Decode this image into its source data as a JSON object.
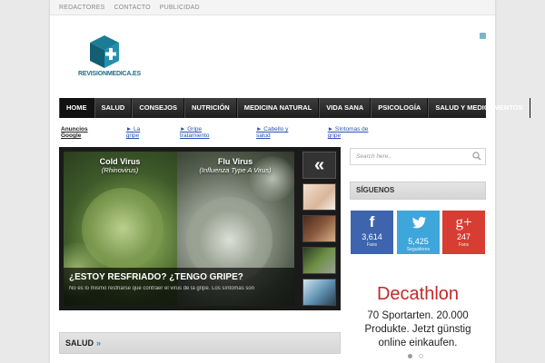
{
  "topbar": {
    "links": [
      "REDACTORES",
      "CONTACTO",
      "PUBLICIDAD"
    ]
  },
  "logo": {
    "text": "REVISIONMEDICA.ES",
    "icon": "medical-cube-logo"
  },
  "nav": {
    "items": [
      "HOME",
      "SALUD",
      "CONSEJOS",
      "NUTRICIÓN",
      "MEDICINA NATURAL",
      "VIDA SANA",
      "PSICOLOGÍA",
      "SALUD Y MEDICAMENTOS"
    ],
    "active": "HOME"
  },
  "adlinks": {
    "title": "Anuncios Google",
    "links": [
      "► La gripe",
      "► Gripe tratamiento",
      "► Cabello y salud",
      "► Síntomas de gripe"
    ]
  },
  "slider": {
    "left_label": "Cold Virus",
    "left_sub": "(Rhinovirus)",
    "right_label": "Flu Virus",
    "right_sub": "(Influenza Type A Virus)",
    "caption_title": "¿ESTOY RESFRIADO? ¿TENGO GRIPE?",
    "caption_excerpt": "No es lo mismo resfriarse que contraer el virus de la gripe. Los síntomas son",
    "prev_arrow": "«"
  },
  "section": {
    "title": "SALUD",
    "arrows": "»"
  },
  "search": {
    "placeholder": "Search here.."
  },
  "follow": {
    "title": "SÍGUENOS",
    "facebook": {
      "glyph": "f",
      "count": "3,614",
      "unit": "Fans"
    },
    "twitter": {
      "glyph": "t",
      "count": "5,425",
      "unit": "Seguidores"
    },
    "googleplus": {
      "glyph": "g+",
      "count": "247",
      "unit": "Fans"
    }
  },
  "ad": {
    "brand": "Decathlon",
    "copy": "70 Sportarten. 20.000 Produkte. Jetzt günstig online einkaufen."
  },
  "colors": {
    "nav_bg": "#2a2a2a",
    "facebook": "#3e64ad",
    "twitter": "#3fa6dc",
    "googleplus": "#d73d32",
    "ad_brand": "#c62828",
    "accent": "#2b8fc1"
  }
}
